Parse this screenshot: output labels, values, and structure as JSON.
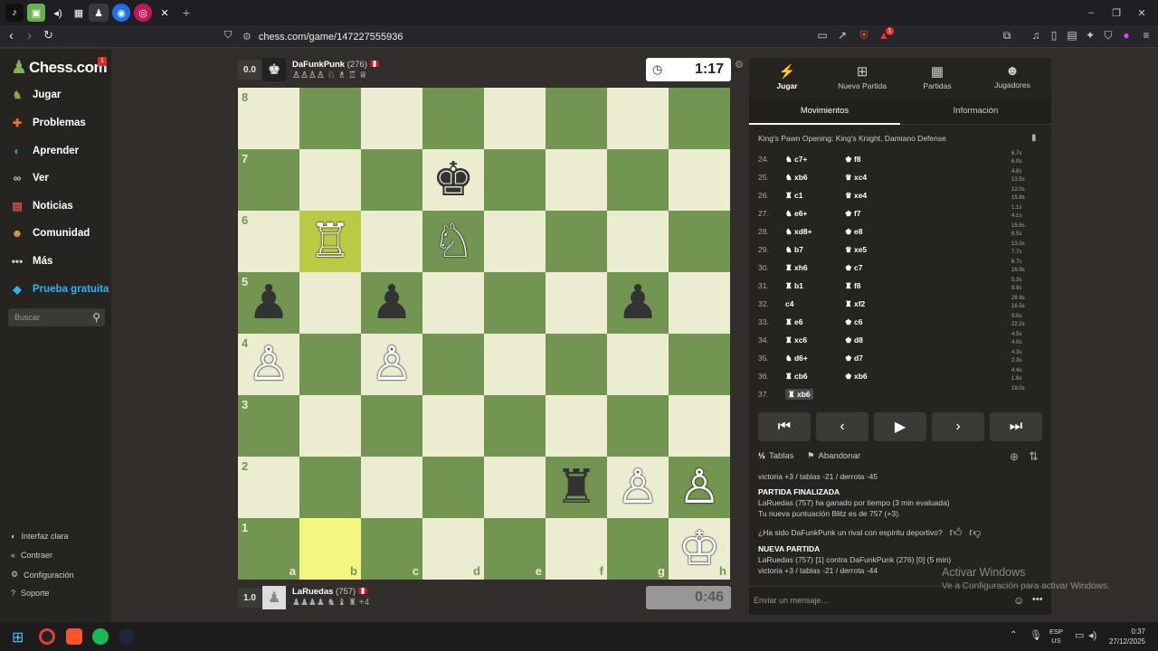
{
  "browser": {
    "url": "chess.com/game/147227555936",
    "new_tab": "+",
    "badge": "1"
  },
  "sidebar": {
    "logo": "Chess.com",
    "logo_badge": "1",
    "items": [
      {
        "label": "Jugar",
        "icon": "play-board-icon",
        "color": "#7fa650"
      },
      {
        "label": "Problemas",
        "icon": "puzzle-icon",
        "color": "#e8742b"
      },
      {
        "label": "Aprender",
        "icon": "learn-icon",
        "color": "#3e9bd6"
      },
      {
        "label": "Ver",
        "icon": "binoculars-icon",
        "color": "#cccccc"
      },
      {
        "label": "Noticias",
        "icon": "news-icon",
        "color": "#d9534f"
      },
      {
        "label": "Comunidad",
        "icon": "community-icon",
        "color": "#e8a23b"
      },
      {
        "label": "Más",
        "icon": "more-icon",
        "color": "#cccccc"
      },
      {
        "label": "Prueba gratuita",
        "icon": "diamond-icon",
        "color": "#29b6f6"
      }
    ],
    "search_placeholder": "Buscar",
    "bottom": [
      "Interfaz clara",
      "Contraer",
      "Configuración",
      "Soporte"
    ]
  },
  "top_player": {
    "score": "0.0",
    "name": "DaFunkPunk",
    "rating": "(276)",
    "captured": "♙♙♙♙ ♘ ♗ ♖ ♕",
    "clock": "1:17"
  },
  "bottom_player": {
    "score": "1.0",
    "name": "LaRuedas",
    "rating": "(757)",
    "captured": "♟♟♟♟ ♞ ♝ ♜",
    "extra": "+4",
    "clock": "0:46"
  },
  "board": {
    "ranks": [
      "8",
      "7",
      "6",
      "5",
      "4",
      "3",
      "2",
      "1"
    ],
    "files": [
      "a",
      "b",
      "c",
      "d",
      "e",
      "f",
      "g",
      "h"
    ],
    "pieces": [
      {
        "sq": "d7",
        "glyph": "♚",
        "color": "b"
      },
      {
        "sq": "b6",
        "glyph": "♖",
        "color": "w"
      },
      {
        "sq": "d6",
        "glyph": "♘",
        "color": "w"
      },
      {
        "sq": "a5",
        "glyph": "♟",
        "color": "b"
      },
      {
        "sq": "c5",
        "glyph": "♟",
        "color": "b"
      },
      {
        "sq": "g5",
        "glyph": "♟",
        "color": "b"
      },
      {
        "sq": "a4",
        "glyph": "♙",
        "color": "w"
      },
      {
        "sq": "c4",
        "glyph": "♙",
        "color": "w"
      },
      {
        "sq": "f2",
        "glyph": "♜",
        "color": "b"
      },
      {
        "sq": "g2",
        "glyph": "♙",
        "color": "w"
      },
      {
        "sq": "h2",
        "glyph": "♙",
        "color": "w"
      },
      {
        "sq": "h1",
        "glyph": "♔",
        "color": "w"
      }
    ],
    "highlights": [
      "b6",
      "b1"
    ]
  },
  "panel": {
    "tabs": [
      "Jugar",
      "Nueva Partida",
      "Partidas",
      "Jugadores"
    ],
    "subtabs": [
      "Movimientos",
      "Información"
    ],
    "opening": "King's Pawn Opening: King's Knight, Damiano Defense",
    "moves": [
      {
        "n": "24.",
        "w": "♞ c7+",
        "b": "♚ f8",
        "wt": "6.7s",
        "bt": "6.0s"
      },
      {
        "n": "25.",
        "w": "♞ xb6",
        "b": "♛ xc4",
        "wt": "4.8s",
        "bt": "13.5s"
      },
      {
        "n": "26.",
        "w": "♜ c1",
        "b": "♛ xe4",
        "wt": "12.0s",
        "bt": "15.8s"
      },
      {
        "n": "27.",
        "w": "♞ e6+",
        "b": "♚ f7",
        "wt": "1.1s",
        "bt": "4.1s"
      },
      {
        "n": "28.",
        "w": "♞ xd8+",
        "b": "♚ e8",
        "wt": "15.6s",
        "bt": "6.5s"
      },
      {
        "n": "29.",
        "w": "♞ b7",
        "b": "♛ xe5",
        "wt": "13.0s",
        "bt": "7.7s"
      },
      {
        "n": "30.",
        "w": "♜ xh6",
        "b": "♚ c7",
        "wt": "6.7s",
        "bt": "16.9s"
      },
      {
        "n": "31.",
        "w": "♜ b1",
        "b": "♜ f8",
        "wt": "5.3s",
        "bt": "8.9s"
      },
      {
        "n": "32.",
        "w": "c4",
        "b": "♜ xf2",
        "wt": "28.9s",
        "bt": "16.5s"
      },
      {
        "n": "33.",
        "w": "♜ e6",
        "b": "♚ c6",
        "wt": "9.0s",
        "bt": "22.2s"
      },
      {
        "n": "34.",
        "w": "♜ xc6",
        "b": "♚ d8",
        "wt": "4.5s",
        "bt": "4.0s"
      },
      {
        "n": "35.",
        "w": "♞ d6+",
        "b": "♚ d7",
        "wt": "4.3s",
        "bt": "2.3s"
      },
      {
        "n": "36.",
        "w": "♜ cb6",
        "b": "♚ xb6",
        "wt": "4.4s",
        "bt": "1.8s"
      },
      {
        "n": "37.",
        "w": "♜ xb6",
        "b": "",
        "wt": "19.0s",
        "bt": ""
      }
    ],
    "draw": "Tablas",
    "resign": "Abandonar",
    "chat": {
      "line0": "victoria +3 / tablas -21 / derrota -45",
      "h1": "PARTIDA FINALIZADA",
      "l1": "LaRuedas (757) ha ganado por tiempo (3 min evaluada)",
      "l2": "Tu nueva puntuación Blitz es de 757 (+3).",
      "q": "¿Ha sido DaFunkPunk un rival con espíritu deportivo?",
      "h2": "NUEVA PARTIDA",
      "l3": "LaRuedas (757) [1] contra DaFunkPunk (276) [0] (5 min)",
      "l4": "victoria +3 / tablas -21 / derrota -44",
      "placeholder": "Enviar un mensaje..."
    }
  },
  "watermark": {
    "t1": "Activar Windows",
    "t2": "Ve a Configuración para activar Windows."
  },
  "taskbar": {
    "lang1": "ESP",
    "lang2": "US",
    "time": "0:37",
    "date": "27/12/2025"
  }
}
